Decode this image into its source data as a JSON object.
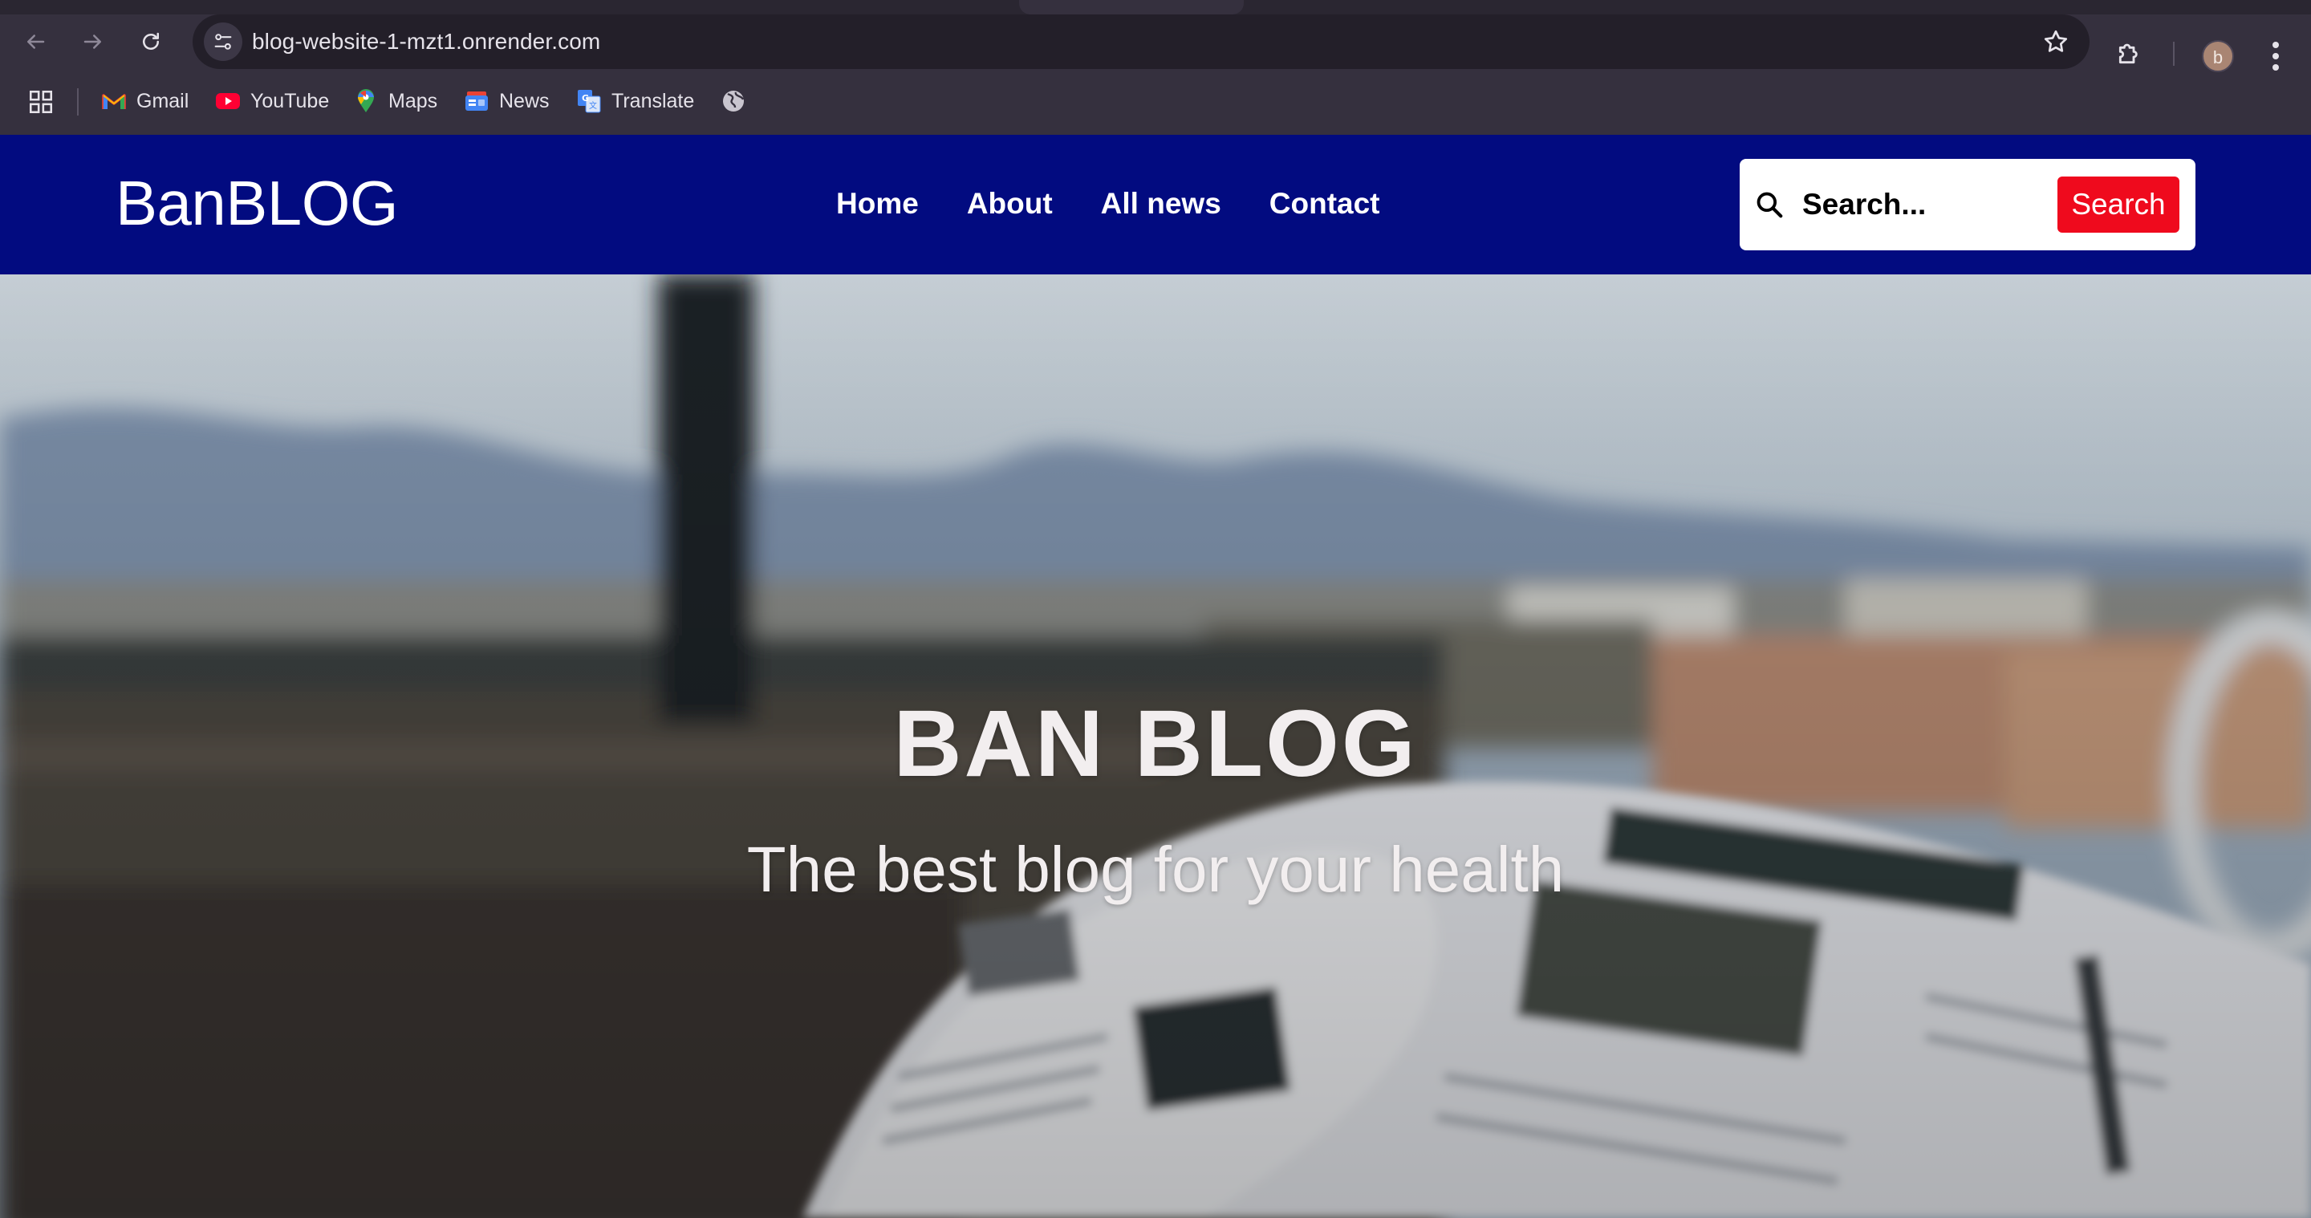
{
  "browser": {
    "url": "blog-website-1-mzt1.onrender.com",
    "profile_initial": "b",
    "bookmarks": [
      {
        "label": "Gmail",
        "icon": "gmail-icon"
      },
      {
        "label": "YouTube",
        "icon": "youtube-icon"
      },
      {
        "label": "Maps",
        "icon": "maps-icon"
      },
      {
        "label": "News",
        "icon": "news-icon"
      },
      {
        "label": "Translate",
        "icon": "translate-icon"
      }
    ]
  },
  "site": {
    "logo": "BanBLOG",
    "nav": [
      "Home",
      "About",
      "All news",
      "Contact"
    ],
    "search": {
      "placeholder": "Search...",
      "button_label": "Search"
    },
    "colors": {
      "header_bg": "#020b80",
      "search_button_bg": "#ef0a1d"
    }
  },
  "hero": {
    "title": "BAN BLOG",
    "subtitle": "The best blog for your health"
  }
}
